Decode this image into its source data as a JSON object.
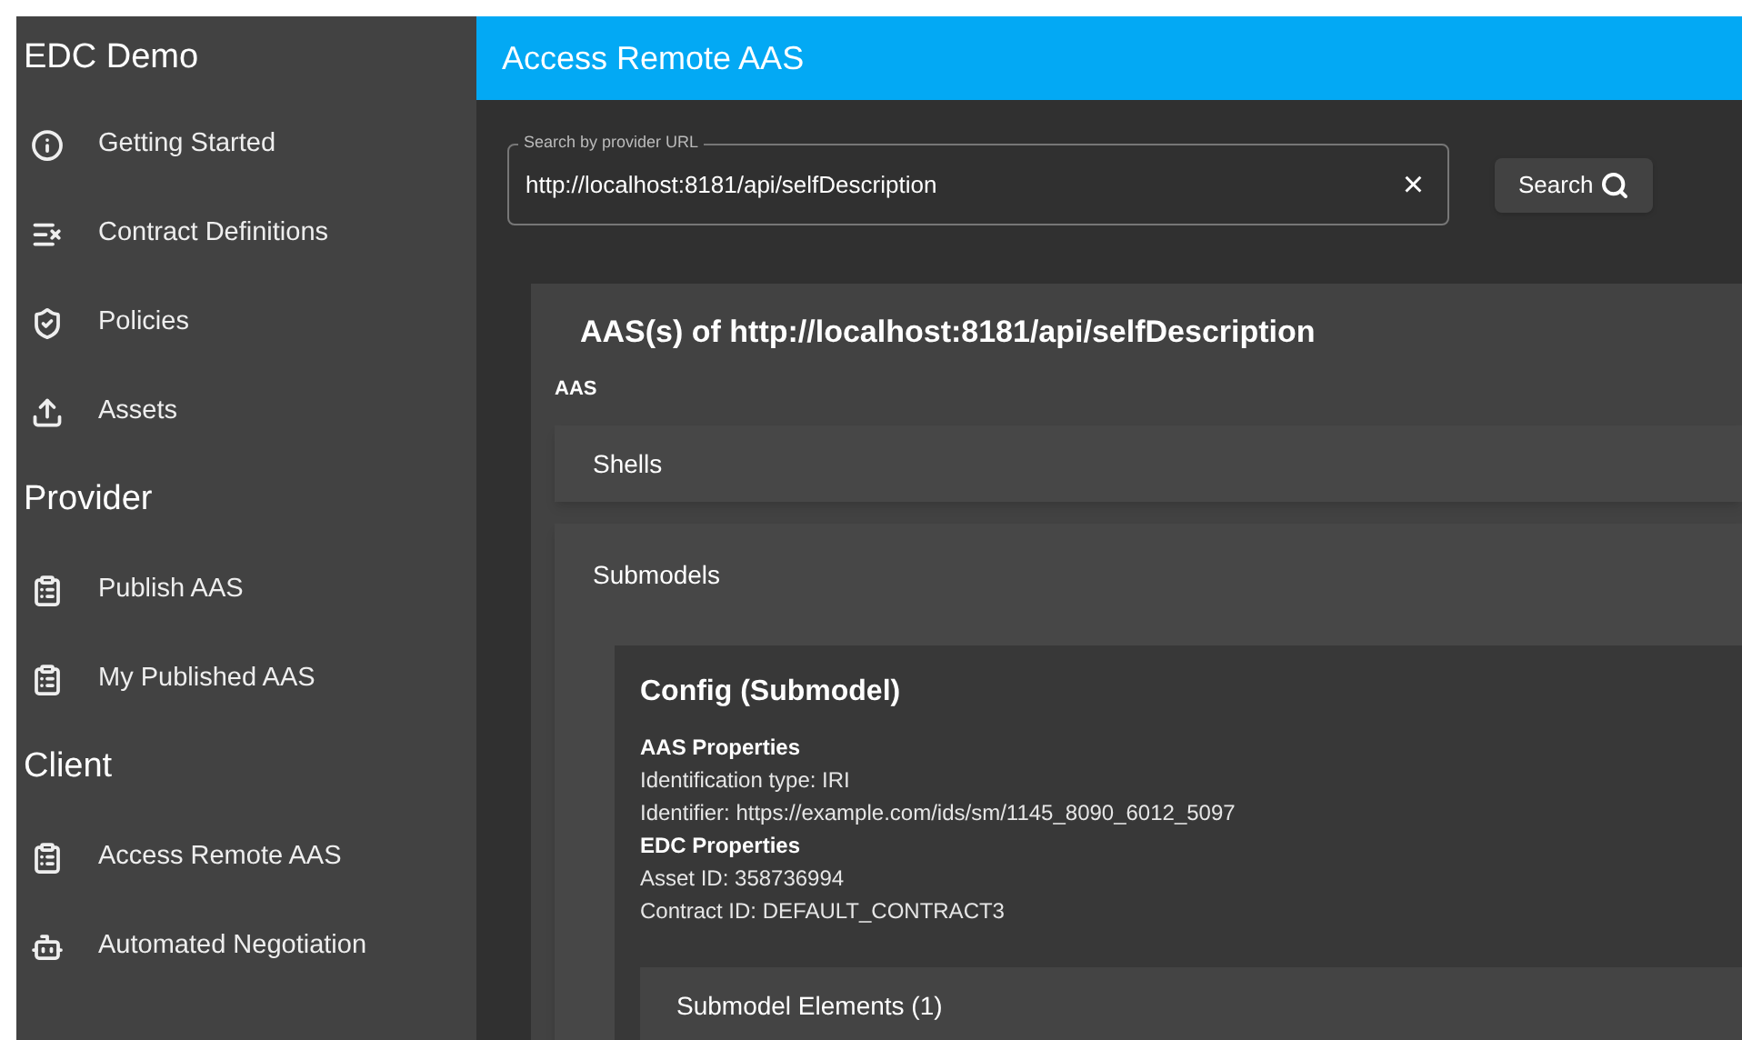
{
  "sidebar": {
    "title": "EDC Demo",
    "sections": [
      {
        "items": [
          {
            "label": "Getting Started"
          },
          {
            "label": "Contract Definitions"
          },
          {
            "label": "Policies"
          },
          {
            "label": "Assets"
          }
        ]
      },
      {
        "heading": "Provider",
        "items": [
          {
            "label": "Publish AAS"
          },
          {
            "label": "My Published AAS"
          }
        ]
      },
      {
        "heading": "Client",
        "items": [
          {
            "label": "Access Remote AAS"
          },
          {
            "label": "Automated Negotiation"
          }
        ]
      }
    ]
  },
  "header": {
    "title": "Access Remote AAS"
  },
  "search": {
    "label": "Search by provider URL",
    "value": "http://localhost:8181/api/selfDescription",
    "clear": "×",
    "button": "Search"
  },
  "result": {
    "title": "AAS(s) of http://localhost:8181/api/selfDescription",
    "subtitle": "AAS",
    "panels": [
      {
        "title": "Shells",
        "expanded": false
      },
      {
        "title": "Submodels",
        "expanded": true,
        "submodels": [
          {
            "title": "Config (Submodel)",
            "groups": [
              {
                "heading": "AAS Properties",
                "lines": [
                  "Identification type: IRI",
                  "Identifier: https://example.com/ids/sm/1145_8090_6012_5097"
                ]
              },
              {
                "heading": "EDC Properties",
                "lines": [
                  "Asset ID: 358736994",
                  "Contract ID: DEFAULT_CONTRACT3"
                ]
              }
            ],
            "elements": {
              "title": "Submodel Elements (1)"
            }
          }
        ]
      }
    ]
  }
}
